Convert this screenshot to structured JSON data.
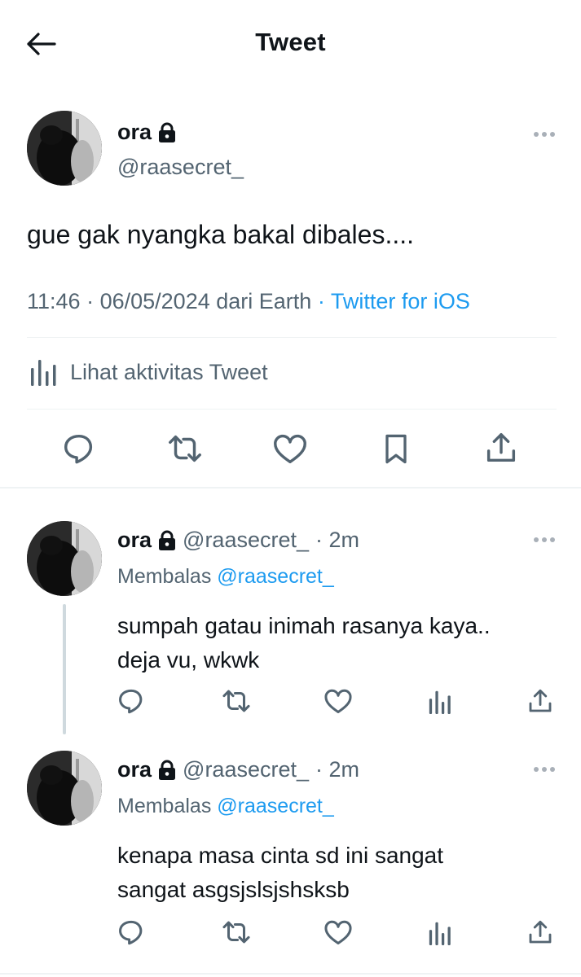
{
  "header": {
    "title": "Tweet"
  },
  "tweet": {
    "name": "ora",
    "handle": "@raasecret_",
    "text": "gue gak nyangka bakal dibales....",
    "time": "11:46",
    "date": "06/05/2024",
    "location": "dari Earth",
    "separator": "·",
    "app": "Twitter for iOS",
    "activity_label": "Lihat aktivitas Tweet"
  },
  "replies": [
    {
      "name": "ora",
      "handle": "@raasecret_",
      "time": "· 2m",
      "replying_label": "Membalas",
      "replying_to": "@raasecret_",
      "line1": "sumpah gatau inimah rasanya kaya..",
      "line2": "deja vu, wkwk"
    },
    {
      "name": "ora",
      "handle": "@raasecret_",
      "time": "· 2m",
      "replying_label": "Membalas",
      "replying_to": "@raasecret_",
      "line1": "kenapa masa cinta sd ini sangat",
      "line2": "sangat asgsjslsjshsksb"
    }
  ],
  "colors": {
    "accent": "#1d9bf0",
    "secondary_text": "#536471",
    "icon": "#536471",
    "text": "#0f1419"
  }
}
